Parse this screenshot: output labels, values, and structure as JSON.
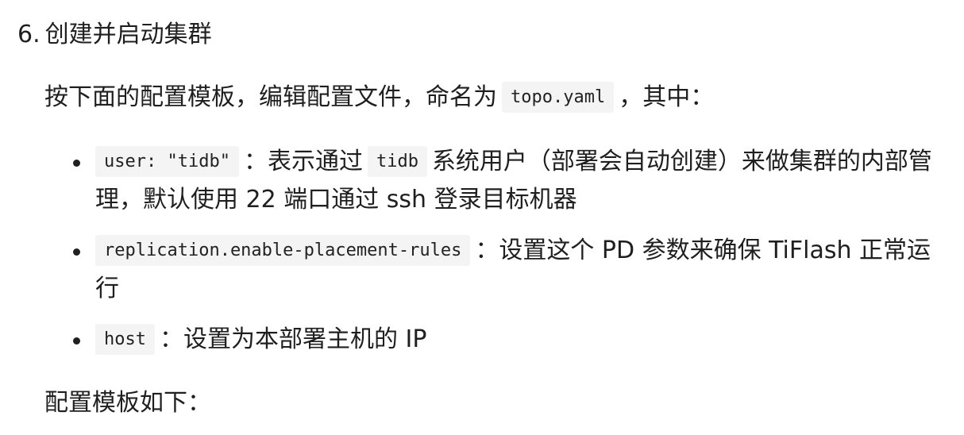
{
  "step": {
    "number": "6.",
    "title": "创建并启动集群"
  },
  "intro": {
    "text_before": "按下面的配置模板，编辑配置文件，命名为",
    "code": "topo.yaml",
    "text_after": "，其中："
  },
  "items": [
    {
      "code": "user: \"tidb\"",
      "text1": "：表示通过",
      "code2": "tidb",
      "text2": "系统用户（部署会自动创建）来做集群的内部管理，默认使用 22 端口通过 ssh 登录目标机器"
    },
    {
      "code": "replication.enable-placement-rules",
      "text1": "：设置这个 PD 参数来确保 TiFlash 正常运行"
    },
    {
      "code": "host",
      "text1": "：设置为本部署主机的 IP"
    }
  ],
  "outro": {
    "text": "配置模板如下："
  }
}
